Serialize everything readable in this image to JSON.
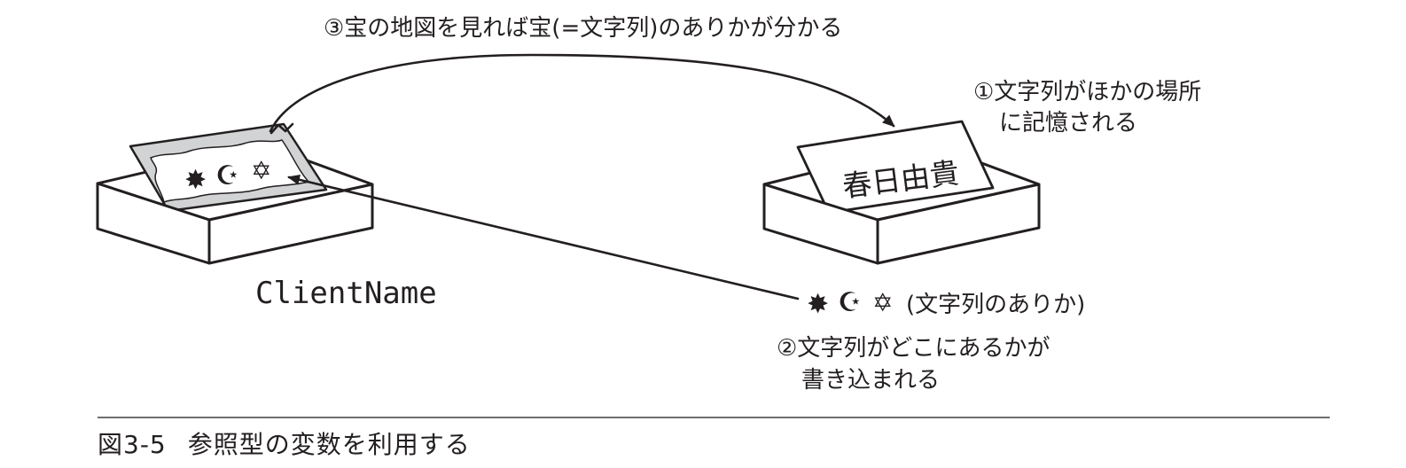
{
  "labels": {
    "step3": "③宝の地図を見れば宝(=文字列)のありかが分かる",
    "step1_line1": "①文字列がほかの場所",
    "step1_line2": "に記憶される",
    "step2_line1": "②文字列がどこにあるかが",
    "step2_line2": "書き込まれる",
    "location_note": "(文字列のありか)",
    "variable_name": "ClientName",
    "stored_string": "春日由貴"
  },
  "symbols": {
    "star_six": "✸",
    "crescent": "☪",
    "david_star": "✡"
  },
  "caption": {
    "number": "図3-5",
    "title": "参照型の変数を利用する"
  },
  "colors": {
    "ink": "#231f20",
    "map_paper": "#d1d3d4",
    "rule": "#6d6e71"
  }
}
